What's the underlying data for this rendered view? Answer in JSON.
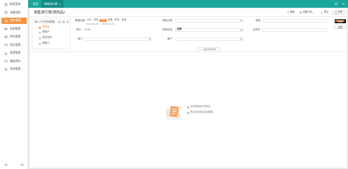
{
  "colors": {
    "brand": "#1aa59c",
    "brand_dark": "#118c84",
    "accent": "#f58a3a",
    "side_active": "#f39546"
  },
  "sidebar": {
    "active_index": 2,
    "items": [
      {
        "label": "报表菜单",
        "icon": "report-icon"
      },
      {
        "label": "快捷导航",
        "icon": "compass-icon"
      },
      {
        "label": "销售管理",
        "icon": "cart-icon"
      },
      {
        "label": "采购管理",
        "icon": "truck-icon"
      },
      {
        "label": "库存管理",
        "icon": "box-icon"
      },
      {
        "label": "资金管理",
        "icon": "wallet-icon"
      },
      {
        "label": "经营管理",
        "icon": "chart-icon"
      },
      {
        "label": "基础资料",
        "icon": "folder-icon"
      },
      {
        "label": "系统管理",
        "icon": "gear-icon"
      }
    ],
    "footer_icons": [
      "collapse-menu-icon",
      "expand-menu-icon"
    ]
  },
  "tabs": [
    {
      "label": "首页"
    },
    {
      "label": "销售排行榜",
      "close": "×"
    }
  ],
  "active_tab_index": 1,
  "window_icons": [
    "restore-icon",
    "close-icon"
  ],
  "page": {
    "title": "销售排行榜(按商品)"
  },
  "toolbar": [
    {
      "label": "刷新",
      "icon": "refresh-icon"
    },
    {
      "label": "设置打印",
      "icon": "printer-icon"
    },
    {
      "label": "导出",
      "icon": "export-icon"
    },
    {
      "label": "关闭",
      "icon": "close-icon"
    }
  ],
  "view_panel": {
    "title": "按以下方式查看数据",
    "selected_index": 0,
    "options": [
      "按商品",
      "按客户",
      "按业务员",
      "按部门"
    ]
  },
  "filters": {
    "date": {
      "label": "单据日期",
      "quick_options": [
        "上月",
        "本月",
        "今天",
        "本周",
        "昨天",
        "前天"
      ],
      "quick_selected_index": 2,
      "from": "2022-01-01",
      "separator": "~",
      "to": "2022-12-31"
    },
    "category": {
      "label": "商品分类"
    },
    "product": {
      "label": "商品"
    },
    "price": {
      "label": "单价",
      "value": "0.00"
    },
    "settle_status": {
      "label": "结算状态",
      "value": "全部"
    },
    "salesman": {
      "label": "业务员"
    },
    "department": {
      "label": "部门"
    },
    "customer": {
      "label": "客户"
    }
  },
  "actions": {
    "search": "查询",
    "reset": "重置",
    "collapse": "收起查询条件"
  },
  "empty_state": {
    "lines": [
      "请先选择统计的条件",
      "再点击查询后显示数据"
    ]
  }
}
